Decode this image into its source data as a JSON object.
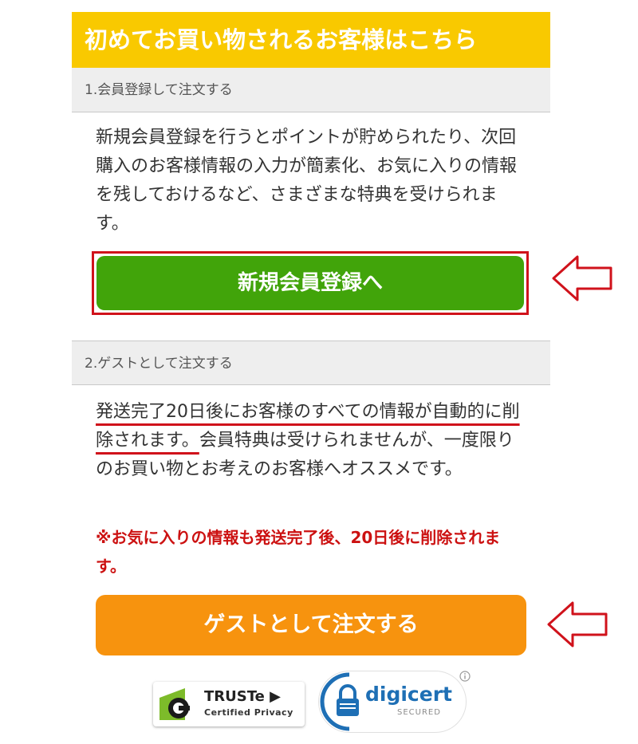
{
  "header": {
    "title": "初めてお買い物されるお客様はこちら"
  },
  "member_section": {
    "heading": "1.会員登録して注文する",
    "description": "新規会員登録を行うとポイントが貯められたり、次回購入のお客様情報の入力が簡素化、お気に入りの情報を残しておけるなど、さまざまな特典を受けられます。",
    "button_label": "新規会員登録へ"
  },
  "guest_section": {
    "heading": "2.ゲストとして注文する",
    "description_highlight": "発送完了20日後にお客様のすべての情報が自動的に削除されます。",
    "description_rest": "会員特典は受けられませんが、一度限りのお買い物とお考えのお客様へオススメです。",
    "notice": "※お気に入りの情報も発送完了後、20日後に削除されます。",
    "button_label": "ゲストとして注文する"
  },
  "badges": {
    "truste": {
      "name": "TRUSTe",
      "subtitle": "Certified Privacy"
    },
    "digicert": {
      "name": "digicert",
      "subtitle": "SECURED"
    }
  },
  "colors": {
    "header_bg": "#f9c900",
    "register_button": "#41a40a",
    "guest_button": "#f7930e",
    "highlight_red": "#d0121b"
  }
}
